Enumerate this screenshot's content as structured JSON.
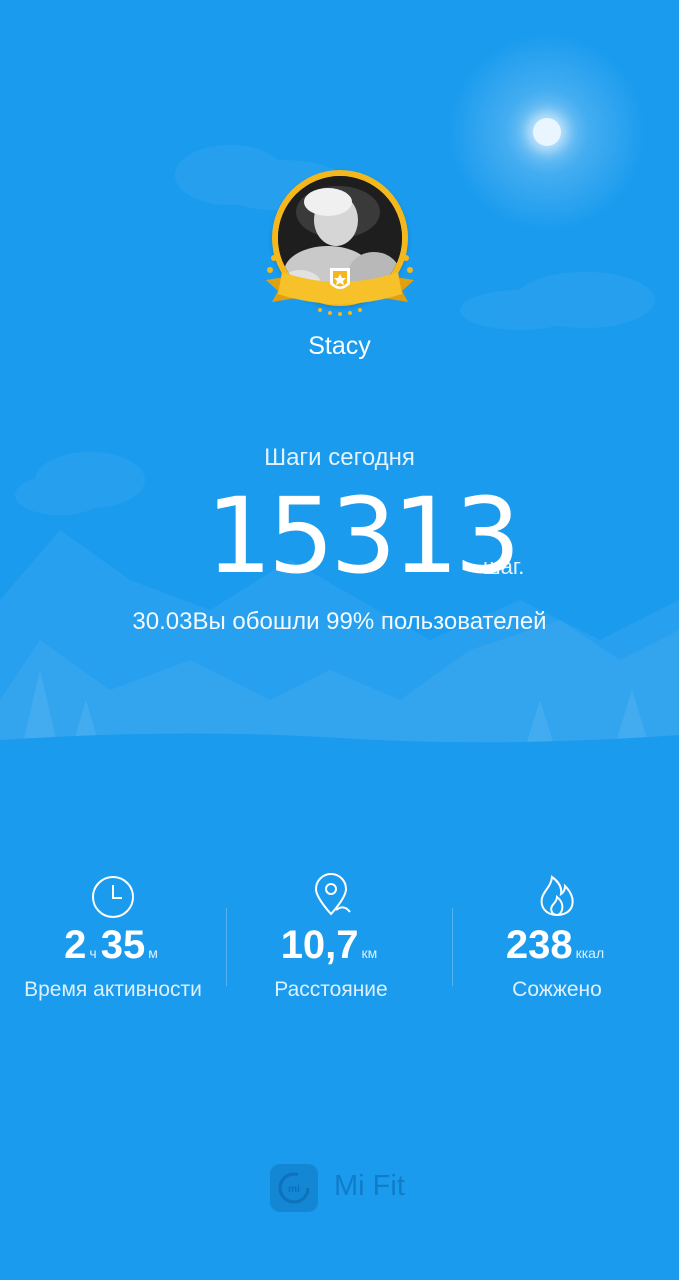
{
  "profile": {
    "name": "Stacy"
  },
  "steps": {
    "label": "Шаги сегодня",
    "value": "15313",
    "unit": "шаг.",
    "comparison": "30.03Вы обошли 99% пользователей"
  },
  "stats": {
    "activity": {
      "hours": "2",
      "hours_unit": "ч",
      "minutes": "35",
      "minutes_unit": "м",
      "label": "Время активности",
      "icon": "clock-icon"
    },
    "distance": {
      "value": "10,7",
      "unit": "км",
      "label": "Расстояние",
      "icon": "location-pin-icon"
    },
    "calories": {
      "value": "238",
      "unit": "ккал",
      "label": "Сожжено",
      "icon": "flame-icon"
    }
  },
  "footer": {
    "logo_text": "mi",
    "brand": "Mi Fit"
  },
  "colors": {
    "background": "#1a9bee",
    "badge_gold": "#f4b81c"
  }
}
